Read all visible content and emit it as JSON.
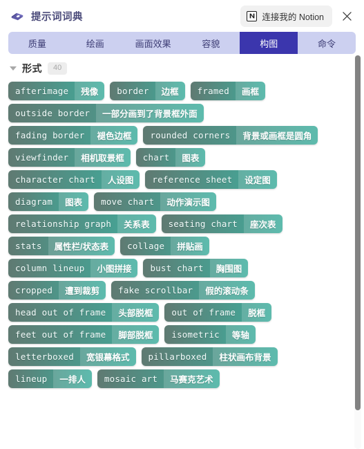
{
  "header": {
    "app_title": "提示词词典",
    "logo_icon": "book-icon",
    "notion_button_label": "连接我的 Notion",
    "notion_logo_icon": "notion-logo-icon",
    "close_icon": "close-icon"
  },
  "tabs": [
    {
      "label": "质量",
      "active": false
    },
    {
      "label": "绘画",
      "active": false
    },
    {
      "label": "画面效果",
      "active": false
    },
    {
      "label": "容貌",
      "active": false
    },
    {
      "label": "构图",
      "active": true
    },
    {
      "label": "命令",
      "active": false
    }
  ],
  "section": {
    "title": "形式",
    "count": "40",
    "caret_icon": "chevron-down-icon",
    "expanded": true
  },
  "colors": {
    "accent_active_tab": "#3b36ad",
    "tabbar_background": "#ccd0f0",
    "brand_text": "#4b4b7a",
    "pill_gradient_start": "#5f7a72",
    "pill_gradient_end": "#3fae9e",
    "scrollbar_thumb": "#828282",
    "count_badge_bg": "#ededed"
  },
  "tag_rows": [
    [
      {
        "en": "afterimage",
        "cn": "残像"
      },
      {
        "en": "border",
        "cn": "边框"
      },
      {
        "en": "framed",
        "cn": "画框"
      }
    ],
    [
      {
        "en": "outside border",
        "cn": "一部分画到了背景框外面"
      }
    ],
    [
      {
        "en": "fading border",
        "cn": "褪色边框"
      },
      {
        "en": "rounded corners",
        "cn": "背景或画框是圆角"
      }
    ],
    [
      {
        "en": "viewfinder",
        "cn": "相机取景框"
      },
      {
        "en": "chart",
        "cn": "图表"
      }
    ],
    [
      {
        "en": "character chart",
        "cn": "人设图"
      },
      {
        "en": "reference sheet",
        "cn": "设定图"
      }
    ],
    [
      {
        "en": "diagram",
        "cn": "图表"
      },
      {
        "en": "move chart",
        "cn": "动作演示图"
      }
    ],
    [
      {
        "en": "relationship graph",
        "cn": "关系表"
      },
      {
        "en": "seating chart",
        "cn": "座次表"
      }
    ],
    [
      {
        "en": "stats",
        "cn": "属性栏/状态表"
      },
      {
        "en": "collage",
        "cn": "拼贴画"
      }
    ],
    [
      {
        "en": "column lineup",
        "cn": "小图拼接"
      },
      {
        "en": "bust chart",
        "cn": "胸围图"
      }
    ],
    [
      {
        "en": "cropped",
        "cn": "遭到裁剪"
      },
      {
        "en": "fake scrollbar",
        "cn": "假的滚动条"
      }
    ],
    [
      {
        "en": "head out of frame",
        "cn": "头部脱框"
      },
      {
        "en": "out of frame",
        "cn": "脱框"
      }
    ],
    [
      {
        "en": "feet out of frame",
        "cn": "脚部脱框"
      },
      {
        "en": "isometric",
        "cn": "等轴"
      }
    ],
    [
      {
        "en": "letterboxed",
        "cn": "宽银幕格式"
      },
      {
        "en": "pillarboxed",
        "cn": "柱状画布背景"
      }
    ],
    [
      {
        "en": "lineup",
        "cn": "一排人"
      },
      {
        "en": "mosaic art",
        "cn": "马赛克艺术"
      }
    ]
  ]
}
